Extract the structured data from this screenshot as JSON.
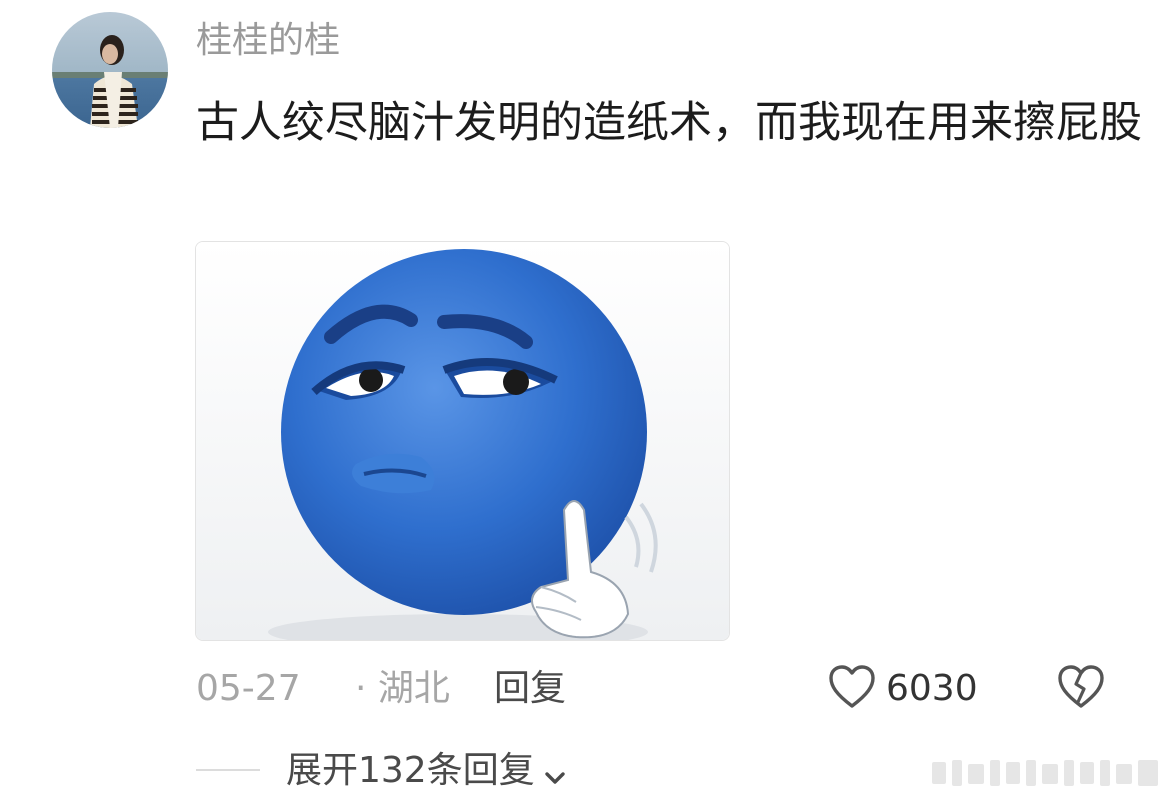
{
  "comment": {
    "username": "桂桂的桂",
    "text": "古人绞尽脑汁发明的造纸术，而我现在用来擦屁股",
    "date": "05-27",
    "location": "· 湖北",
    "reply_label": "回复",
    "like_count": "6030",
    "expand_replies_label": "展开132条回复"
  },
  "icons": {
    "like": "heart-outline-icon",
    "dislike": "broken-heart-icon",
    "expand": "chevron-down-icon"
  },
  "colors": {
    "username": "#9a9a9a",
    "meta": "#a6a6a6",
    "text": "#1c1c1c",
    "emoji_blue": "#2f6fce"
  }
}
